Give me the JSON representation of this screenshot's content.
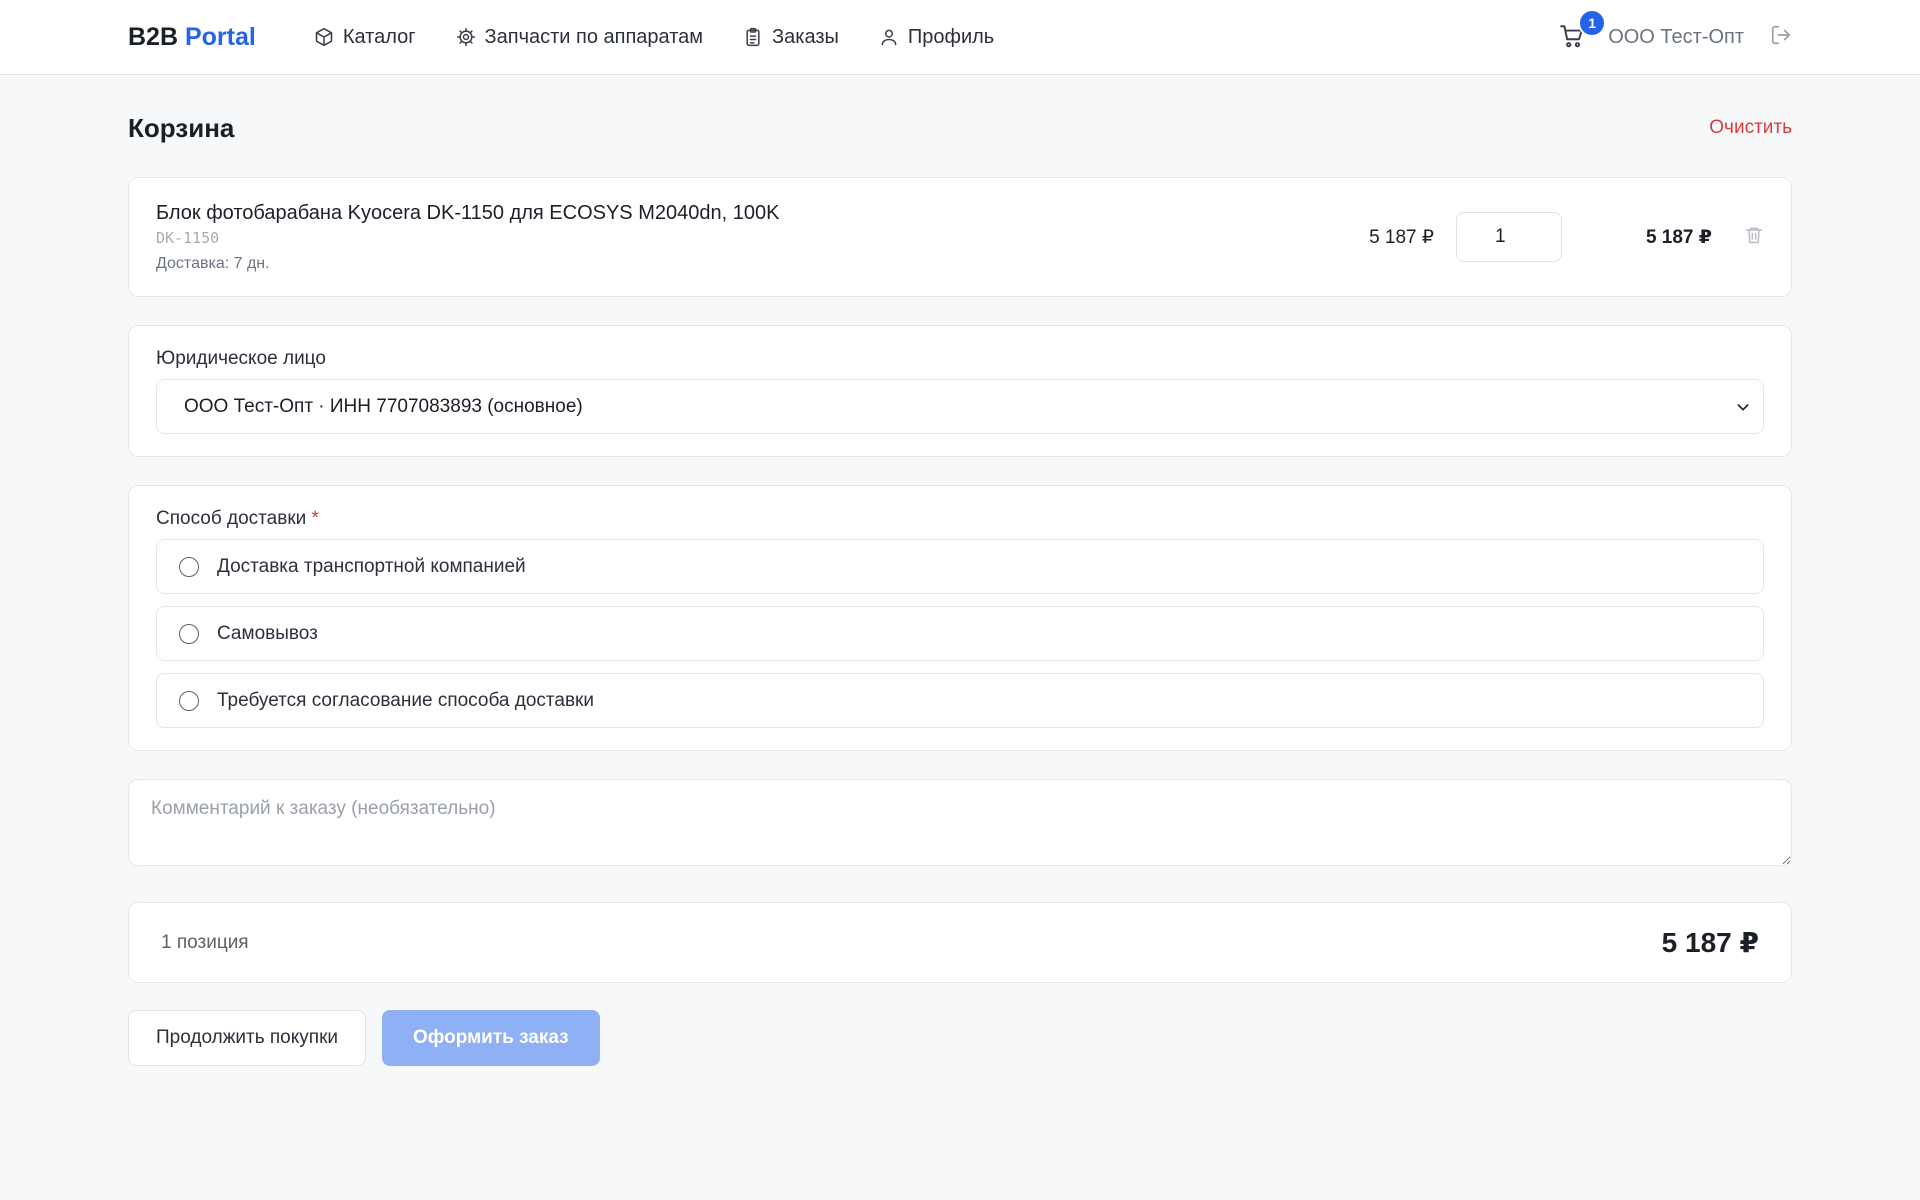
{
  "header": {
    "logo_main": "B2B",
    "logo_accent": "Portal",
    "nav": [
      {
        "label": "Каталог",
        "icon": "box-icon"
      },
      {
        "label": "Запчасти по аппаратам",
        "icon": "gear-icon"
      },
      {
        "label": "Заказы",
        "icon": "clipboard-icon"
      },
      {
        "label": "Профиль",
        "icon": "user-icon"
      }
    ],
    "cart_count": "1",
    "company": "ООО Тест-Опт"
  },
  "page": {
    "title": "Корзина",
    "clear_label": "Очистить"
  },
  "cart_items": [
    {
      "name": "Блок фотобарабана Kyocera DK-1150 для ECOSYS M2040dn, 100K",
      "sku": "DK-1150",
      "delivery": "Доставка: 7 дн.",
      "price": "5 187 ₽",
      "quantity": "1",
      "total": "5 187 ₽"
    }
  ],
  "legal_entity": {
    "label": "Юридическое лицо",
    "selected": "ООО Тест-Опт · ИНН 7707083893 (основное)"
  },
  "delivery": {
    "label": "Способ доставки",
    "required_mark": "*",
    "options": [
      "Доставка транспортной компанией",
      "Самовывоз",
      "Требуется согласование способа доставки"
    ]
  },
  "comment": {
    "placeholder": "Комментарий к заказу (необязательно)"
  },
  "summary": {
    "count": "1 позиция",
    "total": "5 187 ₽"
  },
  "actions": {
    "continue_label": "Продолжить покупки",
    "checkout_label": "Оформить заказ"
  },
  "colors": {
    "accent": "#2563eb",
    "danger": "#dc3b3b",
    "primary_disabled": "#8fb0f5"
  }
}
